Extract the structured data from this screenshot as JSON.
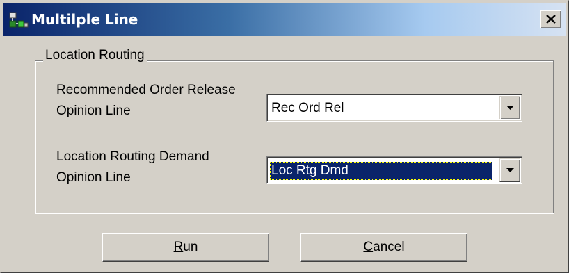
{
  "window": {
    "title": "Multilple Line",
    "close_label": "Close"
  },
  "group": {
    "legend": "Location Routing"
  },
  "fields": [
    {
      "label_line1": "Recommended Order Release",
      "label_line2": "Opinion Line",
      "value": "Rec Ord Rel",
      "selected": false
    },
    {
      "label_line1": "Location Routing Demand",
      "label_line2": "Opinion Line",
      "value": "Loc Rtg Dmd",
      "selected": true
    }
  ],
  "buttons": {
    "run": {
      "accel": "R",
      "rest": "un"
    },
    "cancel": {
      "accel": "C",
      "rest": "ancel"
    }
  },
  "colors": {
    "title_gradient_start": "#0a246a",
    "title_gradient_end": "#d6e2f2",
    "window_face": "#d4d0c8",
    "selection": "#0a246a"
  },
  "icons": {
    "title": "app-network-icon",
    "close": "close-x-icon",
    "dropdown": "dropdown-arrow-icon"
  }
}
